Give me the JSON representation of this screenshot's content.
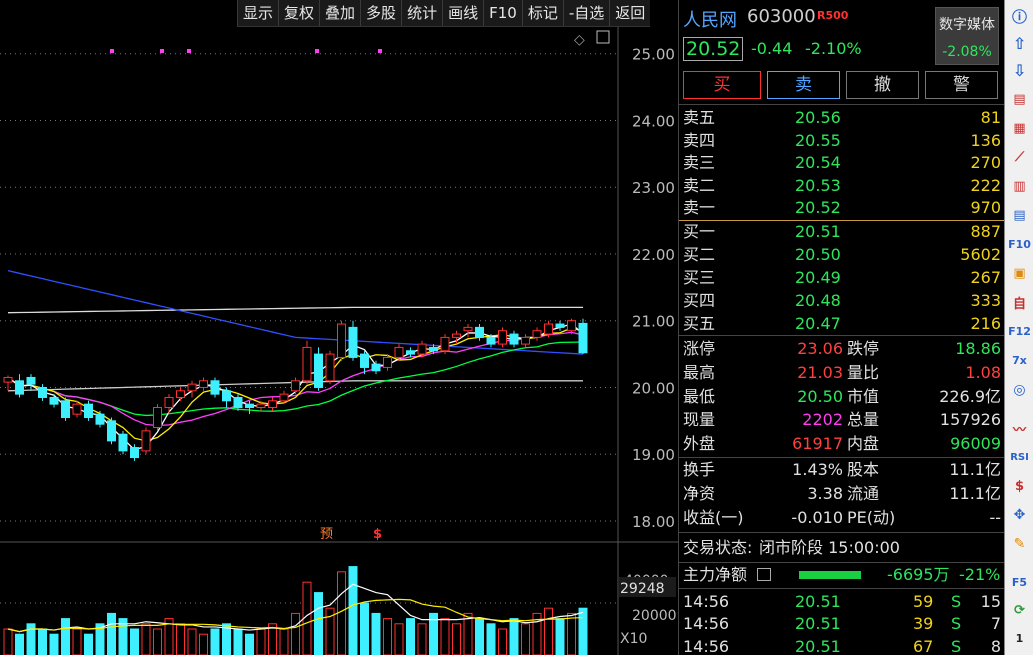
{
  "toolbar": [
    "显示",
    "复权",
    "叠加",
    "多股",
    "统计",
    "画线",
    "F10",
    "标记",
    "-自选",
    "返回"
  ],
  "stock": {
    "name": "人民网",
    "code": "603000",
    "badge": "R500",
    "price": "20.52",
    "change": "-0.44",
    "change_pct": "-2.10%",
    "sector": "数字媒体",
    "sector_pct": "-2.08%"
  },
  "trade_buttons": [
    "买",
    "卖",
    "撤",
    "警"
  ],
  "asks": [
    {
      "label": "卖五",
      "price": "20.56",
      "vol": "81"
    },
    {
      "label": "卖四",
      "price": "20.55",
      "vol": "136"
    },
    {
      "label": "卖三",
      "price": "20.54",
      "vol": "270"
    },
    {
      "label": "卖二",
      "price": "20.53",
      "vol": "222"
    },
    {
      "label": "卖一",
      "price": "20.52",
      "vol": "970"
    }
  ],
  "bids": [
    {
      "label": "买一",
      "price": "20.51",
      "vol": "887"
    },
    {
      "label": "买二",
      "price": "20.50",
      "vol": "5602"
    },
    {
      "label": "买三",
      "price": "20.49",
      "vol": "267"
    },
    {
      "label": "买四",
      "price": "20.48",
      "vol": "333"
    },
    {
      "label": "买五",
      "price": "20.47",
      "vol": "216"
    }
  ],
  "stats": [
    {
      "l1": "涨停",
      "v1": "23.06",
      "c1": "red",
      "l2": "跌停",
      "v2": "18.86",
      "c2": "green"
    },
    {
      "l1": "最高",
      "v1": "21.03",
      "c1": "red",
      "l2": "量比",
      "v2": "1.08",
      "c2": "red"
    },
    {
      "l1": "最低",
      "v1": "20.50",
      "c1": "green",
      "l2": "市值",
      "v2": "226.9亿",
      "c2": "white"
    },
    {
      "l1": "现量",
      "v1": "2202",
      "c1": "magenta",
      "l2": "总量",
      "v2": "157926",
      "c2": "white"
    },
    {
      "l1": "外盘",
      "v1": "61917",
      "c1": "red",
      "l2": "内盘",
      "v2": "96009",
      "c2": "green"
    }
  ],
  "fundamentals": [
    {
      "l1": "换手",
      "v1": "1.43%",
      "l2": "股本",
      "v2": "11.1亿"
    },
    {
      "l1": "净资",
      "v1": "3.38",
      "l2": "流通",
      "v2": "11.1亿"
    },
    {
      "l1": "收益(一)",
      "v1": "-0.010",
      "l2": "PE(动)",
      "v2": "--"
    }
  ],
  "status": {
    "label": "交易状态:",
    "value": "闭市阶段 15:00:00"
  },
  "main_flow": {
    "label": "主力净额",
    "value": "-6695万",
    "pct": "-21%"
  },
  "ticks": [
    {
      "time": "14:56",
      "price": "20.51",
      "vol": "59",
      "side": "S",
      "count": "15"
    },
    {
      "time": "14:56",
      "price": "20.51",
      "vol": "39",
      "side": "S",
      "count": "7"
    },
    {
      "time": "14:56",
      "price": "20.51",
      "vol": "67",
      "side": "S",
      "count": "8"
    }
  ],
  "price_axis": [
    "25.00",
    "24.00",
    "23.00",
    "22.00",
    "21.00",
    "20.00",
    "19.00",
    "18.00"
  ],
  "vol_axis": {
    "top": "40000",
    "cur": "29248",
    "mid": "20000",
    "unit": "X10"
  },
  "markers": {
    "yu": "预",
    "s": "$"
  },
  "colors": {
    "up": "#ff3030",
    "down": "#3ef0ff",
    "ma1": "#ffffff",
    "ma2": "#ffee00",
    "ma3": "#ff40ff",
    "ma4": "#00ff40",
    "ma5": "#3050ff",
    "ma6": "#cccccc"
  },
  "chart_data": {
    "type": "candlestick",
    "ylim": [
      17.7,
      25.4
    ],
    "candles": [
      [
        20.08,
        20.15,
        19.95,
        20.18
      ],
      [
        20.1,
        19.9,
        19.85,
        20.2
      ],
      [
        20.15,
        20.05,
        19.95,
        20.2
      ],
      [
        20.0,
        19.85,
        19.8,
        20.05
      ],
      [
        19.85,
        19.75,
        19.7,
        19.9
      ],
      [
        19.8,
        19.55,
        19.5,
        19.85
      ],
      [
        19.6,
        19.75,
        19.55,
        19.8
      ],
      [
        19.75,
        19.55,
        19.5,
        19.8
      ],
      [
        19.6,
        19.45,
        19.4,
        19.65
      ],
      [
        19.5,
        19.2,
        19.15,
        19.55
      ],
      [
        19.3,
        19.05,
        19.0,
        19.35
      ],
      [
        19.1,
        18.95,
        18.9,
        19.15
      ],
      [
        19.05,
        19.35,
        19.0,
        19.4
      ],
      [
        19.4,
        19.7,
        19.35,
        19.75
      ],
      [
        19.7,
        19.85,
        19.6,
        19.9
      ],
      [
        19.85,
        19.95,
        19.8,
        20.0
      ],
      [
        19.95,
        20.05,
        19.85,
        20.1
      ],
      [
        20.0,
        20.1,
        19.95,
        20.15
      ],
      [
        20.1,
        19.9,
        19.85,
        20.15
      ],
      [
        19.95,
        19.8,
        19.7,
        20.0
      ],
      [
        19.85,
        19.7,
        19.65,
        19.9
      ],
      [
        19.75,
        19.7,
        19.6,
        19.8
      ],
      [
        19.7,
        19.75,
        19.65,
        19.8
      ],
      [
        19.7,
        19.8,
        19.65,
        19.85
      ],
      [
        19.8,
        19.9,
        19.75,
        19.95
      ],
      [
        19.95,
        20.1,
        19.9,
        20.15
      ],
      [
        20.1,
        20.6,
        20.05,
        20.7
      ],
      [
        20.5,
        20.0,
        19.95,
        20.6
      ],
      [
        20.1,
        20.5,
        20.05,
        20.55
      ],
      [
        20.45,
        20.95,
        20.4,
        21.0
      ],
      [
        20.9,
        20.45,
        20.4,
        21.0
      ],
      [
        20.5,
        20.3,
        20.2,
        20.55
      ],
      [
        20.35,
        20.25,
        20.2,
        20.4
      ],
      [
        20.3,
        20.45,
        20.25,
        20.5
      ],
      [
        20.45,
        20.6,
        20.4,
        20.65
      ],
      [
        20.55,
        20.5,
        20.45,
        20.6
      ],
      [
        20.5,
        20.65,
        20.45,
        20.7
      ],
      [
        20.6,
        20.55,
        20.5,
        20.65
      ],
      [
        20.55,
        20.75,
        20.5,
        20.8
      ],
      [
        20.75,
        20.8,
        20.65,
        20.85
      ],
      [
        20.85,
        20.9,
        20.75,
        20.95
      ],
      [
        20.9,
        20.75,
        20.7,
        20.95
      ],
      [
        20.75,
        20.65,
        20.6,
        20.8
      ],
      [
        20.65,
        20.85,
        20.6,
        20.9
      ],
      [
        20.8,
        20.65,
        20.6,
        20.85
      ],
      [
        20.65,
        20.75,
        20.6,
        20.8
      ],
      [
        20.75,
        20.85,
        20.7,
        20.9
      ],
      [
        20.8,
        20.95,
        20.75,
        21.0
      ],
      [
        20.95,
        20.9,
        20.85,
        21.0
      ],
      [
        20.85,
        21.0,
        20.8,
        21.03
      ],
      [
        20.96,
        20.52,
        20.5,
        21.03
      ]
    ],
    "volume": [
      5,
      4,
      6,
      5,
      4,
      7,
      5,
      4,
      6,
      8,
      7,
      5,
      6,
      5,
      7,
      6,
      5,
      4,
      5,
      6,
      5,
      4,
      5,
      6,
      5,
      8,
      14,
      12,
      9,
      16,
      17,
      10,
      8,
      7,
      6,
      7,
      6,
      8,
      7,
      6,
      8,
      7,
      6,
      5,
      7,
      6,
      8,
      9,
      7,
      8,
      9
    ]
  }
}
